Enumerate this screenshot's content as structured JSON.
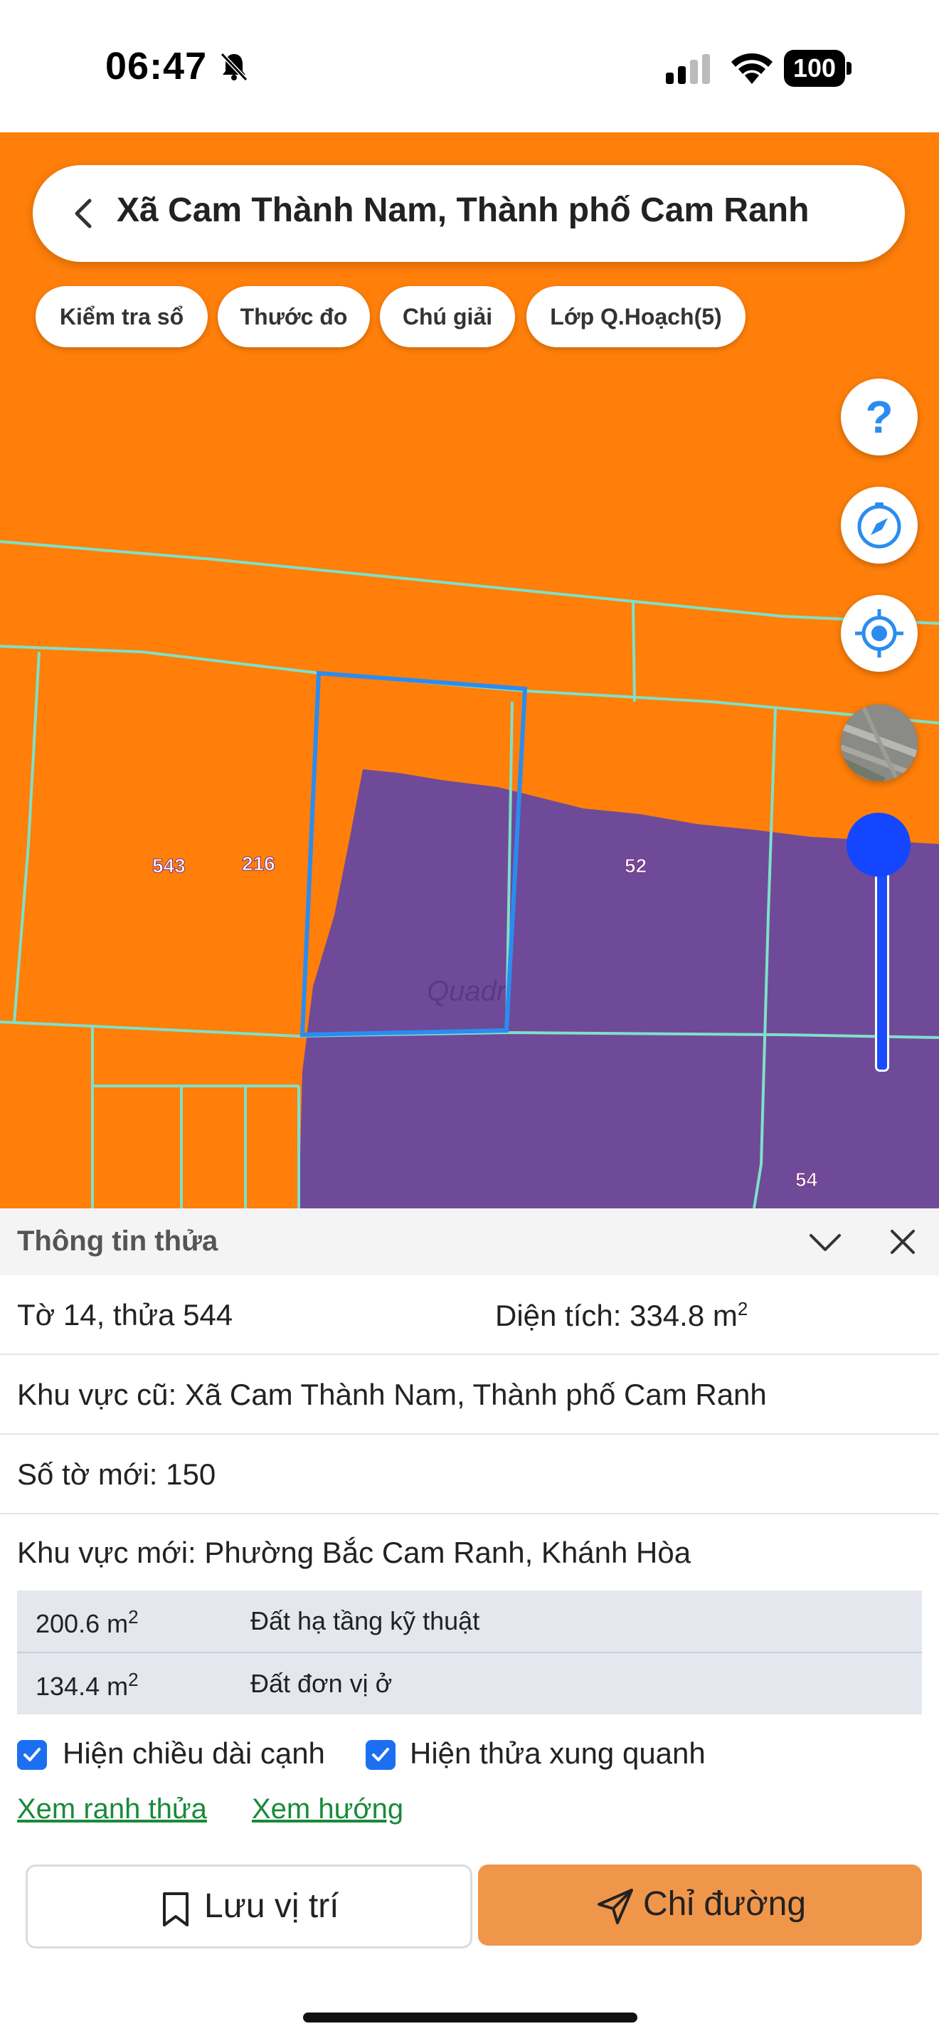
{
  "status": {
    "time": "06:47",
    "battery": "100"
  },
  "search": {
    "title": "Xã Cam Thành Nam, Thành phố Cam Ranh"
  },
  "chips": [
    "Kiểm tra sổ",
    "Thước đo",
    "Chú giải",
    "Lớp Q.Hoạch(5)"
  ],
  "map": {
    "colors": {
      "residential": "#ff7f0a",
      "infrastructure": "#6f4a99",
      "boundary": "#7fe0c8",
      "selected": "#2b8cf0"
    },
    "plot_labels": [
      "543",
      "216",
      "52",
      "54"
    ]
  },
  "icons": [
    "help-icon",
    "compass-icon",
    "locate-icon",
    "satellite-layer-icon"
  ],
  "panel": {
    "title": "Thông tin thửa",
    "sheet_plot": "Tờ 14, thửa 544",
    "area_label": "Diện tích: 334.8 m",
    "area_sup": "2",
    "old_area": "Khu vực cũ: Xã Cam Thành Nam, Thành phố Cam Ranh",
    "new_sheet": "Số tờ mới: 150",
    "new_area": "Khu vực mới: Phường Bắc Cam Ranh, Khánh Hòa",
    "land_use": [
      {
        "area": "200.6 m",
        "sup": "2",
        "type": "Đất hạ tầng kỹ thuật"
      },
      {
        "area": "134.4 m",
        "sup": "2",
        "type": "Đất đơn vị ở"
      }
    ],
    "check_edges": "Hiện chiều dài cạnh",
    "check_neighbors": "Hiện thửa xung quanh",
    "link_boundary": "Xem ranh thửa",
    "link_direction": "Xem hướng",
    "save_label": "Lưu vị trí",
    "directions_label": "Chỉ đường"
  }
}
